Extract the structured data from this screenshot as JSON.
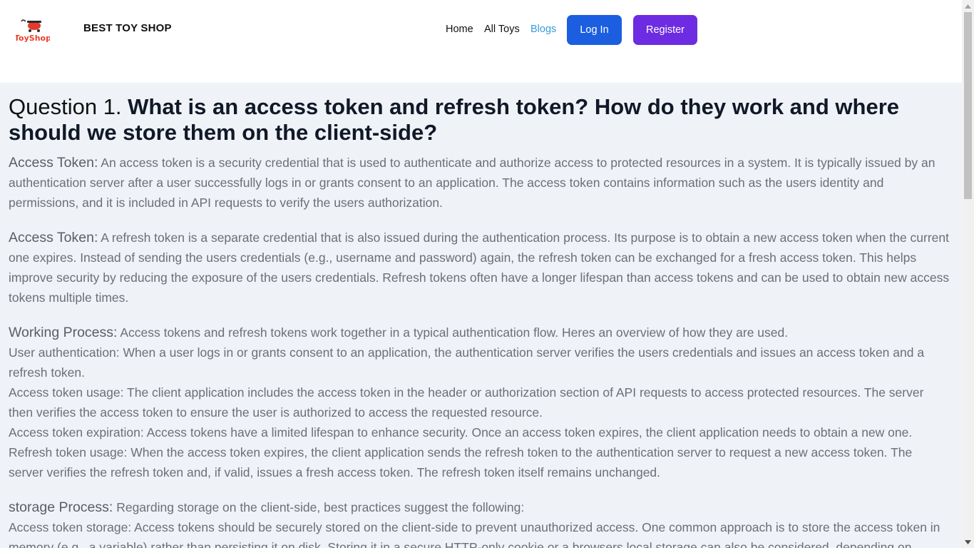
{
  "navbar": {
    "brand_name": "BEST TOY SHOP",
    "logo_text": "ToyShop",
    "links": [
      {
        "label": "Home"
      },
      {
        "label": "All Toys"
      },
      {
        "label": "Blogs",
        "active": true
      }
    ],
    "login_label": "Log In",
    "register_label": "Register"
  },
  "colors": {
    "accent_link": "#3b9bd9",
    "login_button": "#1b5fe0",
    "register_button": "#6d2be2",
    "content_bg": "#eff3f8"
  },
  "article": {
    "question_prefix": "Question 1.",
    "question_text": "What is an access token and refresh token? How do they work and where should we store them on the client-side?",
    "p1_lead": "Access Token:",
    "p1_text": "An access token is a security credential that is used to authenticate and authorize access to protected resources in a system. It is typically issued by an authentication server after a user successfully logs in or grants consent to an application. The access token contains information such as the users identity and permissions, and it is included in API requests to verify the users authorization.",
    "p2_lead": "Access Token:",
    "p2_text": "A refresh token is a separate credential that is also issued during the authentication process. Its purpose is to obtain a new access token when the current one expires. Instead of sending the users credentials (e.g., username and password) again, the refresh token can be exchanged for a fresh access token. This helps improve security by reducing the exposure of the users credentials. Refresh tokens often have a longer lifespan than access tokens and can be used to obtain new access tokens multiple times.",
    "p3_lead": "Working Process:",
    "p3_intro": "Access tokens and refresh tokens work together in a typical authentication flow. Heres an overview of how they are used.",
    "p3_line1": "User authentication: When a user logs in or grants consent to an application, the authentication server verifies the users credentials and issues an access token and a refresh token.",
    "p3_line2": "Access token usage: The client application includes the access token in the header or authorization section of API requests to access protected resources. The server then verifies the access token to ensure the user is authorized to access the requested resource.",
    "p3_line3": "Access token expiration: Access tokens have a limited lifespan to enhance security. Once an access token expires, the client application needs to obtain a new one.",
    "p3_line4": "Refresh token usage: When the access token expires, the client application sends the refresh token to the authentication server to request a new access token. The server verifies the refresh token and, if valid, issues a fresh access token. The refresh token itself remains unchanged.",
    "p4_lead": "storage Process:",
    "p4_intro": "Regarding storage on the client-side, best practices suggest the following:",
    "p4_line1": "Access token storage: Access tokens should be securely stored on the client-side to prevent unauthorized access. One common approach is to store the access token in memory (e.g., a variable) rather than persisting it on disk. Storing it in a secure HTTP-only cookie or a browsers local storage can also be considered, depending on"
  }
}
